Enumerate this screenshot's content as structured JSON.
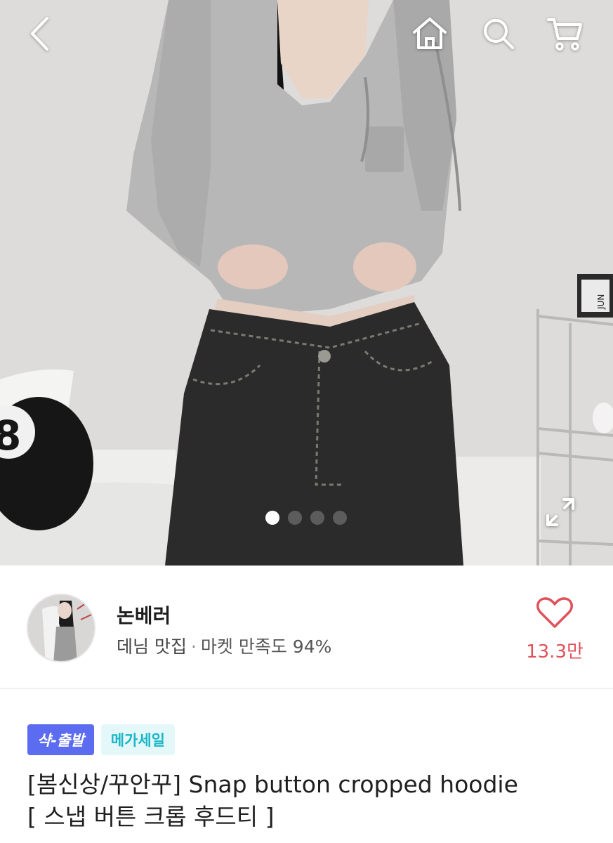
{
  "topbar": {
    "back_icon": "chevron-left-icon",
    "home_icon": "home-icon",
    "search_icon": "search-icon",
    "cart_icon": "cart-icon"
  },
  "gallery": {
    "image_count": 4,
    "active_index": 0,
    "expand_icon": "expand-icon"
  },
  "shop": {
    "name": "논베러",
    "tag": "데님 맛집",
    "separator": "·",
    "satisfaction": "마켓 만족도 94%",
    "like_count": "13.3만",
    "heart_color": "#e0525b"
  },
  "product": {
    "badges": [
      {
        "label": "샥-출발",
        "color": "#5b6cf0"
      },
      {
        "label": "메가세일",
        "color": "#1bb6c8"
      }
    ],
    "title_line1": "[봄신상/꾸안꾸] Snap button cropped hoodie",
    "title_line2": "[ 스냅 버튼 크롭 후드티 ]"
  }
}
